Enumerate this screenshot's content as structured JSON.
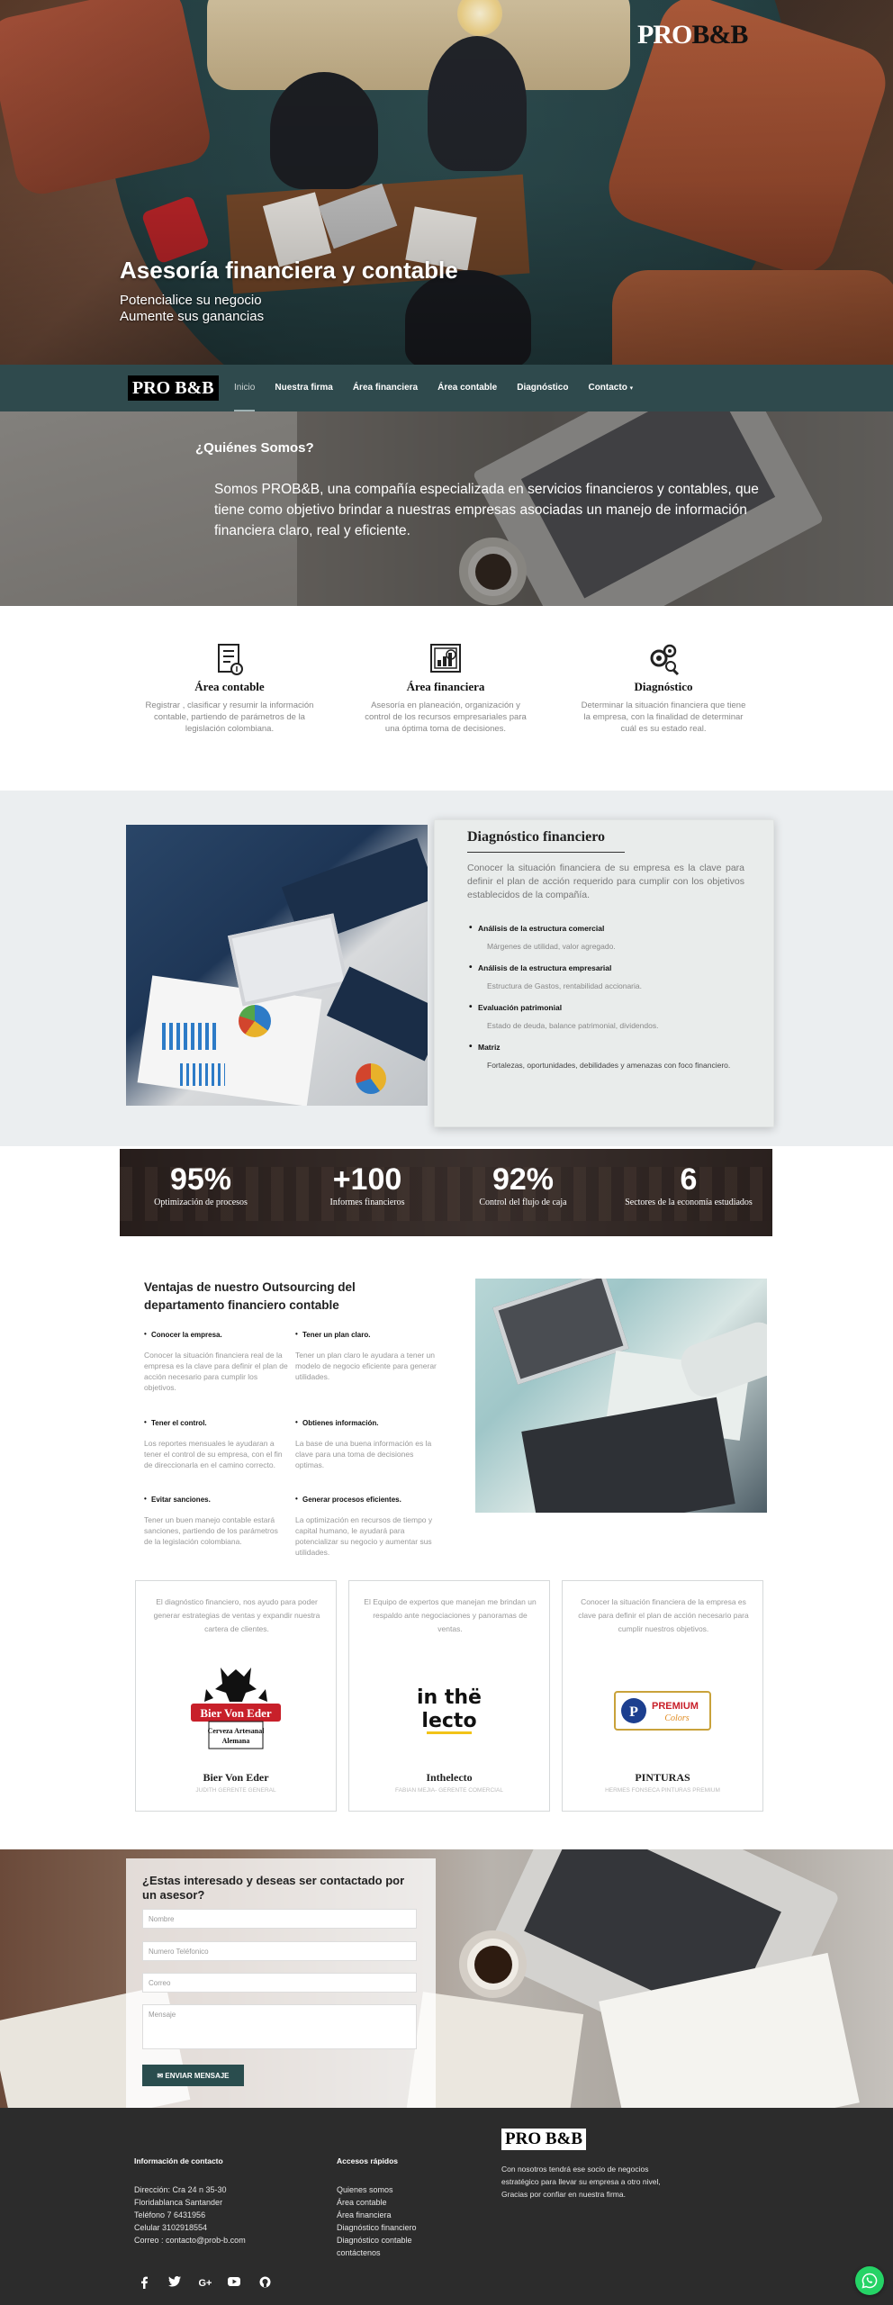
{
  "hero": {
    "logo_pro": "PRO",
    "logo_bb": "B&B",
    "title": "Asesoría financiera y contable",
    "subtitle_line1": "Potencialice su negocio",
    "subtitle_line2": "Aumente sus ganancias"
  },
  "nav": {
    "logo_pro": "PRO",
    "logo_bb": "B&B",
    "items": [
      {
        "label": "Inicio",
        "active": true
      },
      {
        "label": "Nuestra firma"
      },
      {
        "label": "Área financiera"
      },
      {
        "label": "Área contable"
      },
      {
        "label": "Diagnóstico"
      },
      {
        "label": "Contacto",
        "caret": "▾"
      }
    ]
  },
  "about": {
    "question": "¿Quiénes Somos?",
    "text": "Somos PROB&B, una compañía especializada en servicios financieros y contables, que tiene como objetivo brindar a nuestras empresas asociadas un manejo de información financiera claro, real y eficiente."
  },
  "features": [
    {
      "icon": "document-icon",
      "title": "Área contable",
      "desc": "Registrar , clasificar y resumir la información contable, partiendo de parámetros de la legislación colombiana."
    },
    {
      "icon": "chart-icon",
      "title": "Área financiera",
      "desc": "Asesoría en planeación, organización y control de los recursos empresariales para una óptima toma de decisiones."
    },
    {
      "icon": "gears-icon",
      "title": "Diagnóstico",
      "desc": "Determinar la situación financiera que tiene la empresa, con la finalidad de determinar cuál es su estado real."
    }
  ],
  "diagnostico": {
    "title": "Diagnóstico financiero",
    "intro": "Conocer la situación financiera de su empresa es la clave para definir el plan de acción requerido para  cumplir con los objetivos establecidos de la compañía.",
    "items": [
      {
        "heading": "Análisis de la estructura comercial",
        "detail": "Márgenes de utilidad, valor agregado."
      },
      {
        "heading": "Análisis de la estructura empresarial",
        "detail": "Estructura de Gastos, rentabilidad accionaria."
      },
      {
        "heading": "Evaluación patrimonial",
        "detail": "Estado de deuda, balance patrimonial, dividendos."
      },
      {
        "heading": "Matriz",
        "detail": "Fortalezas, oportunidades, debilidades y amenazas con foco financiero."
      }
    ]
  },
  "stats": [
    {
      "value": "95%",
      "label": "Optimización de procesos"
    },
    {
      "value": "+100",
      "label": "Informes financieros"
    },
    {
      "value": "92%",
      "label": "Control del flujo de caja"
    },
    {
      "value": "6",
      "label": "Sectores de la economía estudiados"
    }
  ],
  "ventajas": {
    "title": "Ventajas de nuestro Outsourcing del departamento financiero contable",
    "items": [
      {
        "heading": "Conocer la empresa.",
        "detail": "Conocer la situación financiera real de la empresa es la clave para definir el plan de acción necesario para cumplir los objetivos."
      },
      {
        "heading": "Tener un plan claro.",
        "detail": "Tener un plan claro le ayudara a tener un modelo de negocio eficiente para generar utilidades."
      },
      {
        "heading": "Tener el control.",
        "detail": "Los reportes mensuales le ayudaran a tener el control de su empresa, con el fin de direccionarla en el camino correcto."
      },
      {
        "heading": "Obtienes información.",
        "detail": "La base de una buena información es la clave para una toma de decisiones optimas."
      },
      {
        "heading": "Evitar sanciones.",
        "detail": "Tener un buen manejo contable estará sanciones, partiendo de los parámetros de la legislación colombiana."
      },
      {
        "heading": "Generar procesos eficientes.",
        "detail": "La optimización en recursos de tiempo y capital humano, le ayudará para potencializar su negocio y aumentar sus utilidades."
      }
    ]
  },
  "testimonials": [
    {
      "desc": "El diagnóstico financiero, nos ayudo para poder generar estrategias de ventas y expandir nuestra cartera de clientes.",
      "name": "Bier Von Eder",
      "role": "JUDITH GERENTE GENERAL",
      "logo_line1": "Bier Von Eder",
      "logo_line2": "Cerveza Artesanal",
      "logo_line3": "Alemana"
    },
    {
      "desc": "El Equipo de expertos que manejan me brindan un respaldo ante negociaciones y panoramas de ventas.",
      "name": "Inthelecto",
      "role": "FABIAN MEJIA- GERENTE COMERCIAL",
      "logo_line1": "in thë",
      "logo_line2": "lecto"
    },
    {
      "desc": "Conocer la situación financiera de la empresa es clave para definir el plan de acción necesario para cumplir nuestros objetivos.",
      "name": "PINTURAS",
      "role": "HERMES FONSECA PINTURAS PREMIUM",
      "logo_line1": "PREMIUM",
      "logo_line2": "Colors"
    }
  ],
  "contact": {
    "title": "¿Estas interesado y deseas ser contactado por un asesor?",
    "name_placeholder": "Nombre",
    "phone_placeholder": "Numero Teléfonico",
    "email_placeholder": "Correo",
    "message_placeholder": "Mensaje",
    "send_label": "✉ ENVIAR MENSAJE"
  },
  "footer": {
    "info_heading": "Información de contacto",
    "info_lines": [
      "Dirección: Cra 24 n 35-30",
      "Floridablanca Santander",
      "Teléfono 7 6431956",
      "Celular 3102918554",
      "Correo : contacto@prob-b.com"
    ],
    "links_heading": "Accesos rápidos",
    "links": [
      "Quienes somos",
      "Área contable",
      "Área financiera",
      "Diagnóstico financiero",
      "Diagnóstico contable",
      "contáctenos"
    ],
    "logo_pro": "PRO",
    "logo_bb": "B&B",
    "about": "Con nosotros tendrá ese socio de negocios estratégico para llevar su empresa a otro nivel, Gracias por confiar en nuestra firma.",
    "social_icons": [
      "facebook-icon",
      "twitter-icon",
      "google-plus-icon",
      "youtube-icon",
      "github-icon"
    ]
  },
  "colors": {
    "nav_bg": "#2f4a4d",
    "button_bg": "#2a4d4e",
    "footer_bg": "#2c2c2c",
    "whatsapp": "#25d366"
  }
}
